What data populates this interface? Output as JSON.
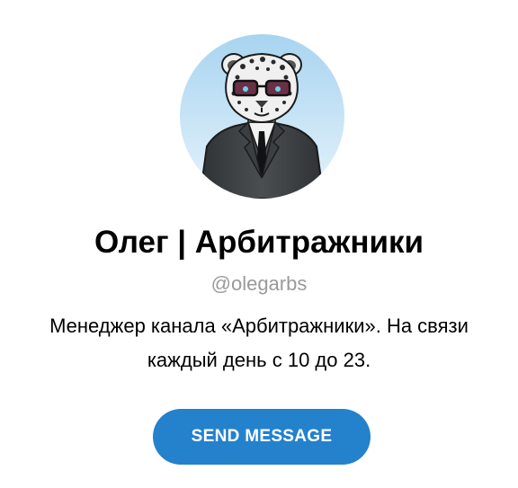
{
  "profile": {
    "name": "Олег | Арбитражники",
    "username": "@olegarbs",
    "bio": "Менеджер канала «Арбитражники». На связи каждый день с 10 до 23.",
    "avatar_icon": "snow-leopard-in-suit-avatar"
  },
  "actions": {
    "send_message_label": "SEND MESSAGE"
  },
  "colors": {
    "accent": "#2481cc",
    "username": "#9a9a9a",
    "avatar_bg_top": "#a8d4f0",
    "avatar_bg_bottom": "#e6f3fb"
  }
}
